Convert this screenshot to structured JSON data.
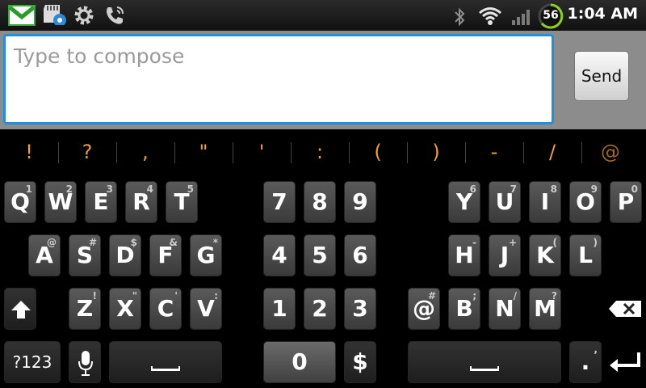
{
  "status_bar": {
    "time": "1:04 AM",
    "battery_level": "56",
    "icons": [
      "gmail-icon",
      "sd-card-settings-icon",
      "settings-gear-icon",
      "phone-icon",
      "bluetooth-icon",
      "wifi-icon",
      "signal-icon",
      "battery-icon"
    ]
  },
  "compose": {
    "placeholder": "Type to compose",
    "send_label": "Send"
  },
  "suggestions": [
    "!",
    "?",
    ",",
    "\"",
    "'",
    ":",
    "(",
    ")",
    "-",
    "/",
    "@"
  ],
  "keys": {
    "q": {
      "label": "Q",
      "hint": "1"
    },
    "w": {
      "label": "W",
      "hint": "2"
    },
    "e": {
      "label": "E",
      "hint": "3"
    },
    "r": {
      "label": "R",
      "hint": "4"
    },
    "t": {
      "label": "T",
      "hint": "5"
    },
    "y": {
      "label": "Y",
      "hint": "6"
    },
    "u": {
      "label": "U",
      "hint": "7"
    },
    "i": {
      "label": "I",
      "hint": "8"
    },
    "o": {
      "label": "O",
      "hint": "9"
    },
    "p": {
      "label": "P",
      "hint": "0"
    },
    "a": {
      "label": "A",
      "hint": "@"
    },
    "s": {
      "label": "S",
      "hint": "#"
    },
    "d": {
      "label": "D",
      "hint": "$"
    },
    "f": {
      "label": "F",
      "hint": "&"
    },
    "g": {
      "label": "G",
      "hint": "*"
    },
    "h": {
      "label": "H",
      "hint": "-"
    },
    "j": {
      "label": "J",
      "hint": "+"
    },
    "k": {
      "label": "K",
      "hint": "("
    },
    "l": {
      "label": "L",
      "hint": ")"
    },
    "z": {
      "label": "Z",
      "hint": "!"
    },
    "x": {
      "label": "X",
      "hint": "\""
    },
    "c": {
      "label": "C",
      "hint": "'"
    },
    "v": {
      "label": "V",
      "hint": ":"
    },
    "at": {
      "label": "@",
      "hint": "#"
    },
    "b": {
      "label": "B",
      "hint": ";"
    },
    "n": {
      "label": "N",
      "hint": "/"
    },
    "m": {
      "label": "M",
      "hint": "?"
    },
    "n7": {
      "label": "7"
    },
    "n8": {
      "label": "8"
    },
    "n9": {
      "label": "9"
    },
    "n4": {
      "label": "4"
    },
    "n5": {
      "label": "5"
    },
    "n6": {
      "label": "6"
    },
    "n1": {
      "label": "1"
    },
    "n2": {
      "label": "2"
    },
    "n3": {
      "label": "3"
    },
    "n0": {
      "label": "0"
    },
    "dollar": {
      "label": "$"
    },
    "mode": {
      "label": "?123"
    },
    "period": {
      "label": ".",
      "hint": ","
    }
  }
}
